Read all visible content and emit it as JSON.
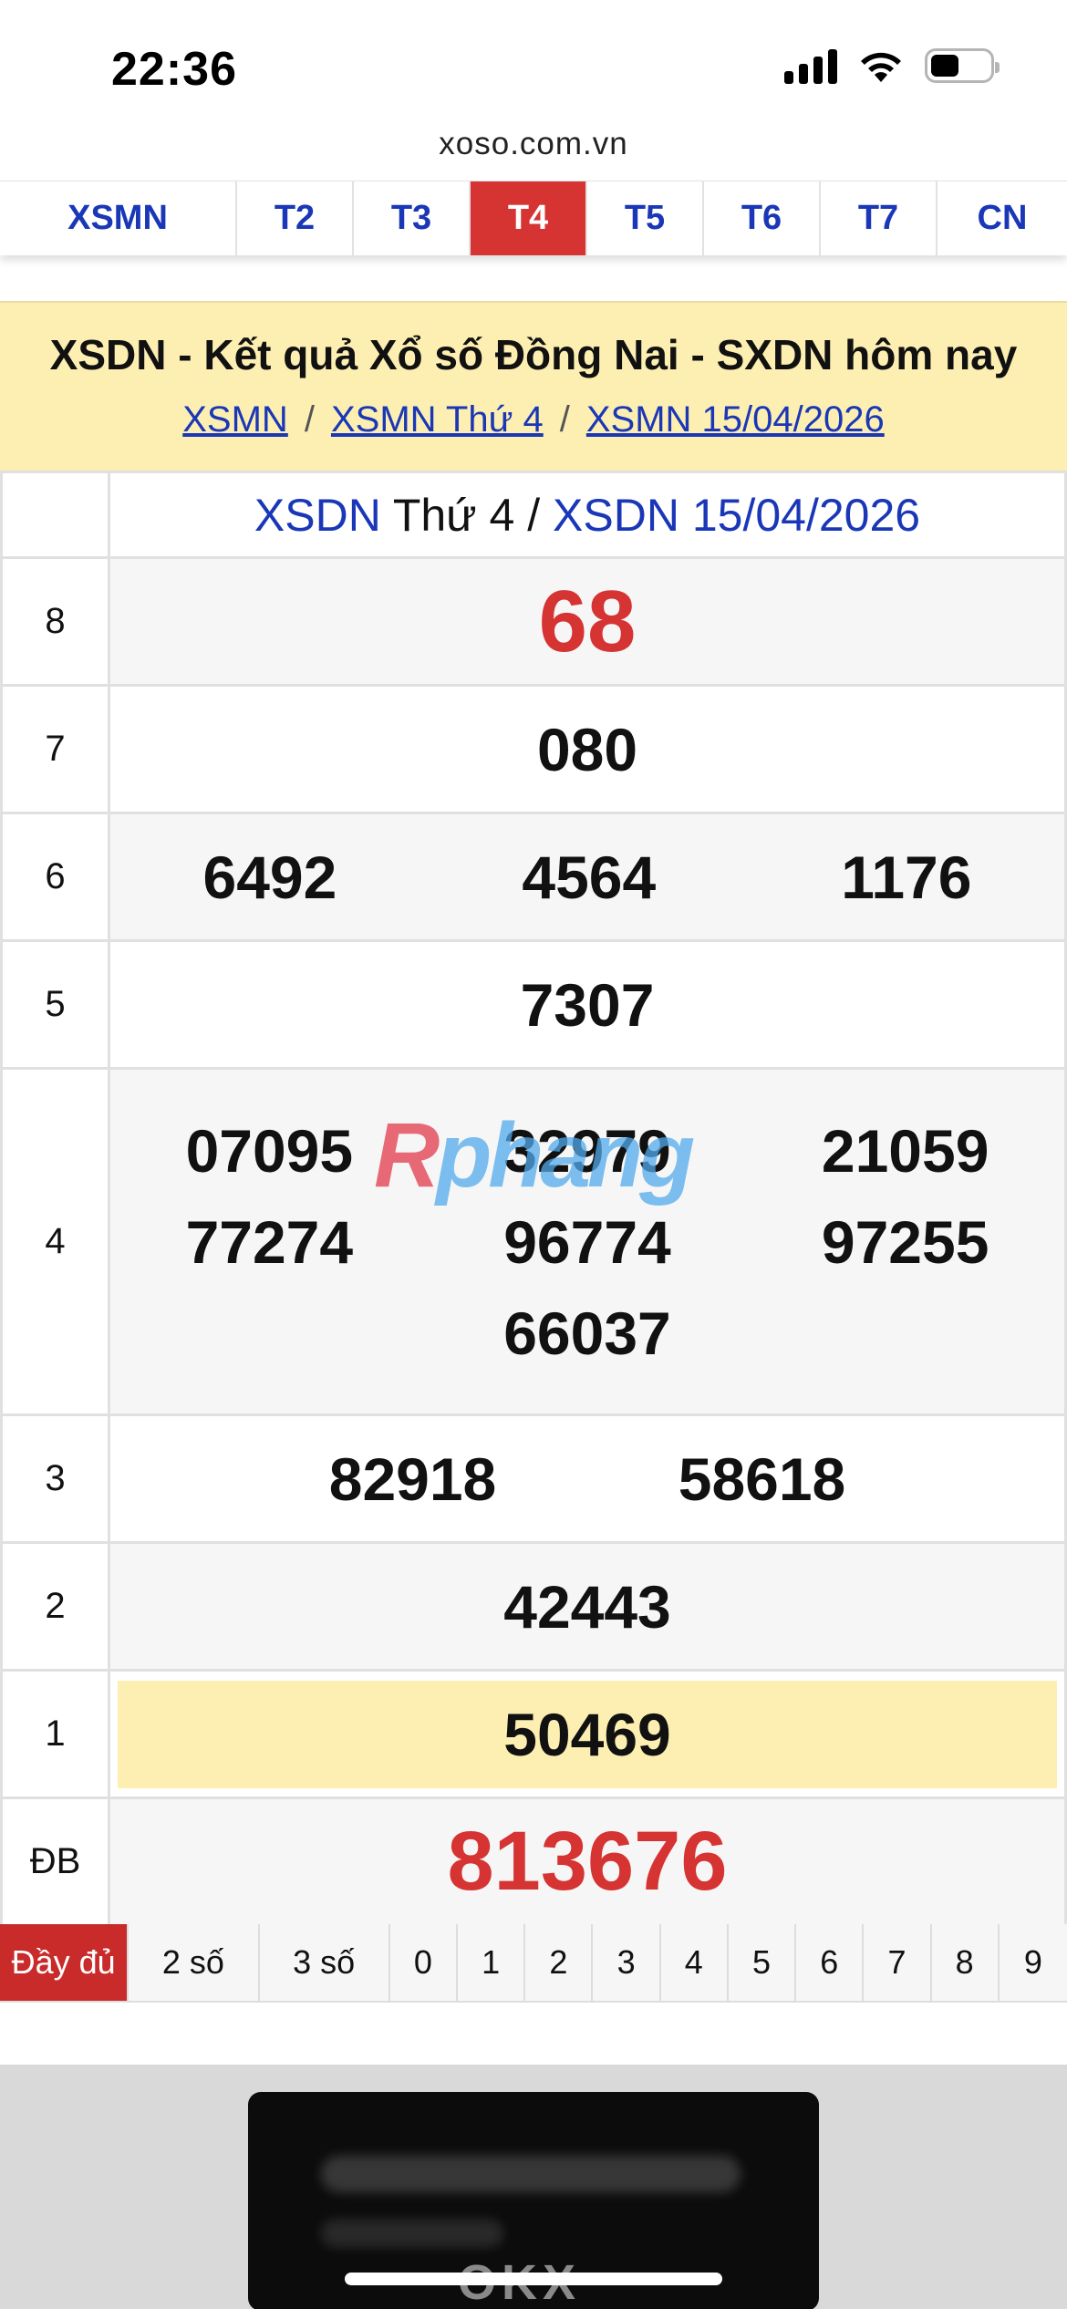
{
  "status_bar": {
    "time": "22:36"
  },
  "browser": {
    "url": "xoso.com.vn"
  },
  "tabs": [
    {
      "label": "XSMN",
      "active": false
    },
    {
      "label": "T2",
      "active": false
    },
    {
      "label": "T3",
      "active": false
    },
    {
      "label": "T4",
      "active": true
    },
    {
      "label": "T5",
      "active": false
    },
    {
      "label": "T6",
      "active": false
    },
    {
      "label": "T7",
      "active": false
    },
    {
      "label": "CN",
      "active": false
    }
  ],
  "header": {
    "title": "XSDN - Kết quả Xổ số Đồng Nai - SXDN hôm nay",
    "breadcrumb": [
      "XSMN",
      "XSMN Thứ 4",
      "XSMN 15/04/2026"
    ],
    "separator": "/"
  },
  "table": {
    "title_prefix": "XSDN",
    "title_day": " Thứ 4 / ",
    "title_date": "XSDN 15/04/2026",
    "rows": [
      {
        "label": "8",
        "values": [
          "68"
        ]
      },
      {
        "label": "7",
        "values": [
          "080"
        ]
      },
      {
        "label": "6",
        "values": [
          "6492",
          "4564",
          "1176"
        ]
      },
      {
        "label": "5",
        "values": [
          "7307"
        ]
      },
      {
        "label": "4",
        "values": [
          "07095",
          "32979",
          "21059",
          "77274",
          "96774",
          "97255",
          "66037"
        ]
      },
      {
        "label": "3",
        "values": [
          "82918",
          "58618"
        ]
      },
      {
        "label": "2",
        "values": [
          "42443"
        ]
      },
      {
        "label": "1",
        "values": [
          "50469"
        ]
      },
      {
        "label": "ĐB",
        "values": [
          "813676"
        ]
      }
    ]
  },
  "watermark": {
    "part1": "R",
    "part2": "phang"
  },
  "filters": [
    "Đầy đủ",
    "2 số",
    "3 số",
    "0",
    "1",
    "2",
    "3",
    "4",
    "5",
    "6",
    "7",
    "8",
    "9"
  ],
  "ad": {
    "logo_text": "OKX"
  },
  "colors": {
    "accent_red": "#d63333",
    "link_blue": "#1a37b7",
    "header_bg": "#fdefb1"
  }
}
